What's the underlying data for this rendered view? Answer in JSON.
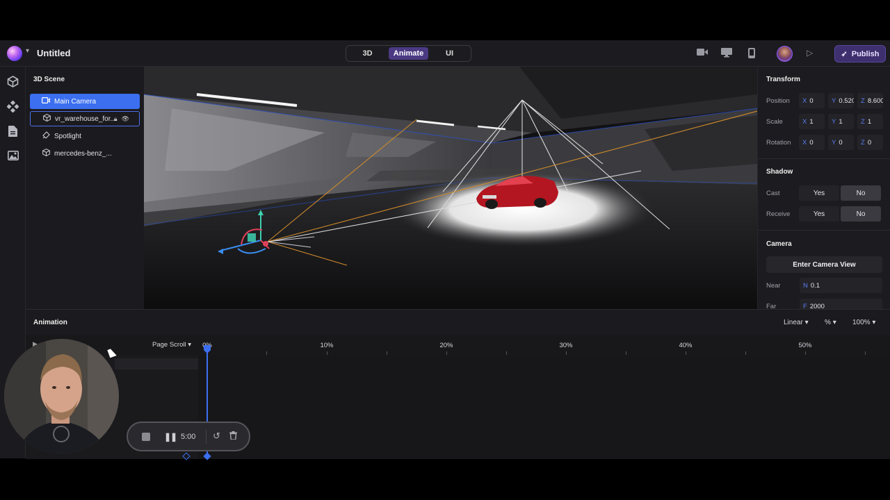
{
  "app": {
    "title": "Untitled"
  },
  "modes": [
    {
      "label": "3D",
      "active": false
    },
    {
      "label": "Animate",
      "active": true
    },
    {
      "label": "UI",
      "active": false
    }
  ],
  "topbar": {
    "publish_label": "Publish",
    "icons": [
      "video-camera-icon",
      "desktop-icon",
      "mobile-icon",
      "play-icon"
    ]
  },
  "scene": {
    "title": "3D Scene",
    "items": [
      {
        "label": "Main Camera",
        "icon": "camera-icon",
        "selected": true
      },
      {
        "label": "vr_warehouse_for...",
        "icon": "cube-icon",
        "highlighted": true
      },
      {
        "label": "Spotlight",
        "icon": "spotlight-icon"
      },
      {
        "label": "mercedes-benz_...",
        "icon": "cube-icon"
      }
    ]
  },
  "props": {
    "transform_title": "Transform",
    "position_label": "Position",
    "position": {
      "x": "0",
      "y": "0.520",
      "z": "8.600"
    },
    "scale_label": "Scale",
    "scale": {
      "x": "1",
      "y": "1",
      "z": "1"
    },
    "rotation_label": "Rotation",
    "rotation": {
      "x": "0",
      "y": "0",
      "z": "0"
    },
    "axis": {
      "x": "X",
      "y": "Y",
      "z": "Z"
    },
    "shadow_title": "Shadow",
    "cast_label": "Cast",
    "receive_label": "Receive",
    "yes": "Yes",
    "no": "No",
    "camera_title": "Camera",
    "enter_camera_view": "Enter Camera View",
    "near_label": "Near",
    "near_axis": "N",
    "near_value": "0.1",
    "far_label": "Far",
    "far_axis": "F",
    "far_value": "2000"
  },
  "animation": {
    "title": "Animation",
    "easing": "Linear",
    "unit": "%",
    "zoom": "100%",
    "trigger": "Page Scroll",
    "ticks": [
      "0%",
      "10%",
      "20%",
      "30%",
      "40%",
      "50%"
    ]
  },
  "recorder": {
    "time": "5:00"
  },
  "colors": {
    "accent": "#3b6ff0",
    "active_mode": "#4b3a83",
    "publish": "#3e2f6e"
  }
}
